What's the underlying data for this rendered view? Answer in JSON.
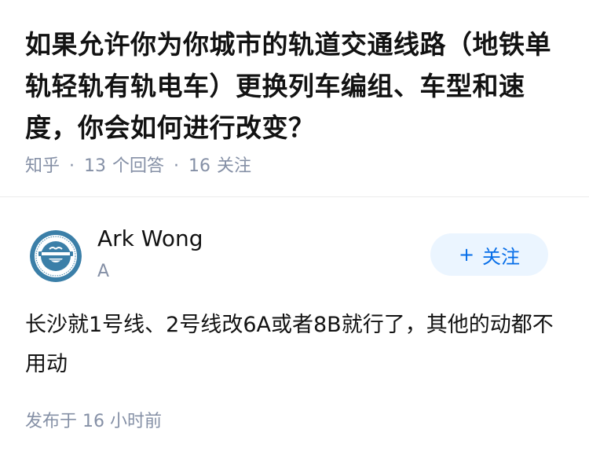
{
  "question": {
    "title": "如果允许你为你城市的轨道交通线路（地铁单轨轻轨有轨电车）更换列车编组、车型和速度，你会如何进行改变？",
    "source": "知乎",
    "answer_count": "13",
    "answer_count_label": "个回答",
    "follower_count": "16",
    "follower_count_label": "关注"
  },
  "answer": {
    "author": {
      "name": "Ark Wong",
      "tag": "A",
      "avatar_icon": "laughing-man-logo-icon"
    },
    "follow_button": {
      "plus": "+",
      "label": "关注"
    },
    "content": "长沙就1号线、2号线改6A或者8B就行了，其他的动都不用动",
    "published": "发布于  16 小时前"
  },
  "colors": {
    "text_primary": "#121212",
    "text_secondary": "#8590a6",
    "accent": "#056de8",
    "accent_bg": "#ebf5ff",
    "avatar_blue": "#3b7fa8"
  }
}
